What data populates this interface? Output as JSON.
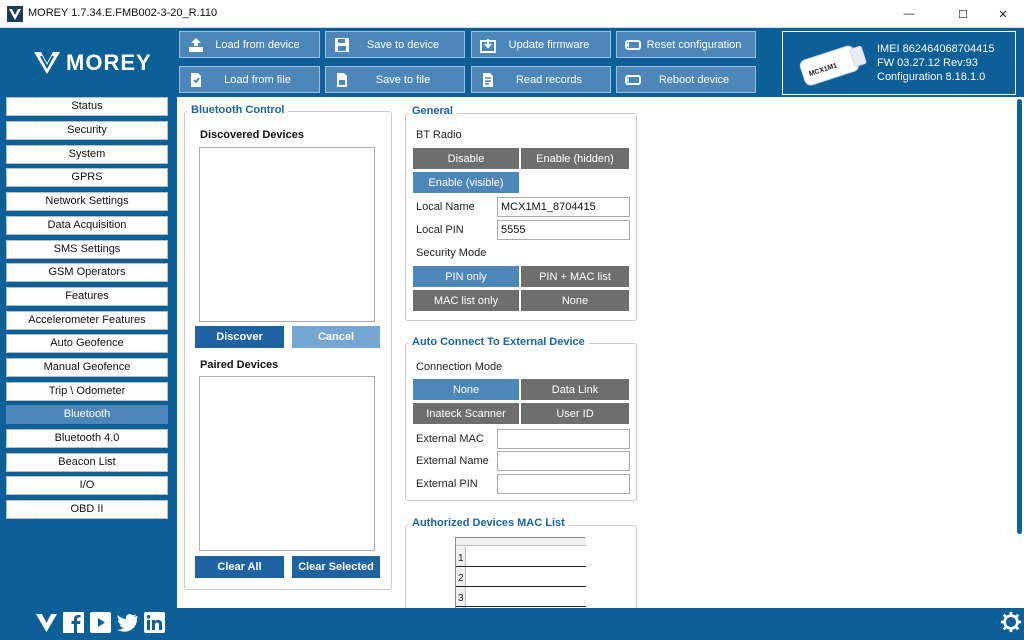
{
  "window": {
    "title": "MOREY 1.7.34.E.FMB002-3-20_R.110",
    "minimize_glyph": "—",
    "maximize_glyph": "☐",
    "close_glyph": "✕"
  },
  "brand": {
    "logo_text": "MOREY"
  },
  "toolbar": {
    "load_from_device": "Load from device",
    "save_to_device": "Save to device",
    "update_firmware": "Update firmware",
    "reset_configuration": "Reset configuration",
    "load_from_file": "Load from file",
    "save_to_file": "Save to file",
    "read_records": "Read records",
    "reboot_device": "Reboot device"
  },
  "device": {
    "device_label": "MCX1M1",
    "imei": "IMEI  862464068704415",
    "fw": "FW  03.27.12 Rev:93",
    "configuration": "Configuration  8.18.1.0"
  },
  "sidebar": {
    "items": [
      "Status",
      "Security",
      "System",
      "GPRS",
      "Network Settings",
      "Data Acquisition",
      "SMS Settings",
      "GSM Operators",
      "Features",
      "Accelerometer Features",
      "Auto Geofence",
      "Manual Geofence",
      "Trip \\ Odometer",
      "Bluetooth",
      "Bluetooth 4.0",
      "Beacon List",
      "I/O",
      "OBD II"
    ],
    "active": "Bluetooth"
  },
  "bluetooth_control": {
    "title": "Bluetooth Control",
    "discovered_label": "Discovered Devices",
    "discover_btn": "Discover",
    "cancel_btn": "Cancel",
    "paired_label": "Paired Devices",
    "clear_all_btn": "Clear All",
    "clear_selected_btn": "Clear Selected"
  },
  "general": {
    "title": "General",
    "bt_radio_label": "BT Radio",
    "bt_radio_options": [
      "Disable",
      "Enable (hidden)",
      "Enable (visible)"
    ],
    "bt_radio_selected": "Enable (visible)",
    "local_name_label": "Local Name",
    "local_name_value": "MCX1M1_8704415",
    "local_pin_label": "Local PIN",
    "local_pin_value": "5555",
    "security_mode_label": "Security Mode",
    "security_options": [
      "PIN only",
      "PIN + MAC list",
      "MAC list only",
      "None"
    ],
    "security_selected": "PIN only"
  },
  "auto_connect": {
    "title": "Auto Connect To External Device",
    "connection_mode_label": "Connection Mode",
    "mode_options": [
      "None",
      "Data Link",
      "Inateck Scanner",
      "User ID"
    ],
    "mode_selected": "None",
    "external_mac_label": "External MAC",
    "external_mac_value": "",
    "external_name_label": "External Name",
    "external_name_value": "",
    "external_pin_label": "External PIN",
    "external_pin_value": ""
  },
  "mac_list": {
    "title": "Authorized Devices MAC List",
    "rows": [
      "1",
      "2",
      "3"
    ]
  },
  "colors": {
    "frame_blue": "#0d5f98",
    "button_blue": "#4d87ba",
    "segment_gray": "#6e6e6e",
    "group_title": "#1c64a0"
  },
  "social_icons": [
    "morey-icon",
    "facebook-icon",
    "youtube-icon",
    "twitter-icon",
    "linkedin-icon"
  ]
}
